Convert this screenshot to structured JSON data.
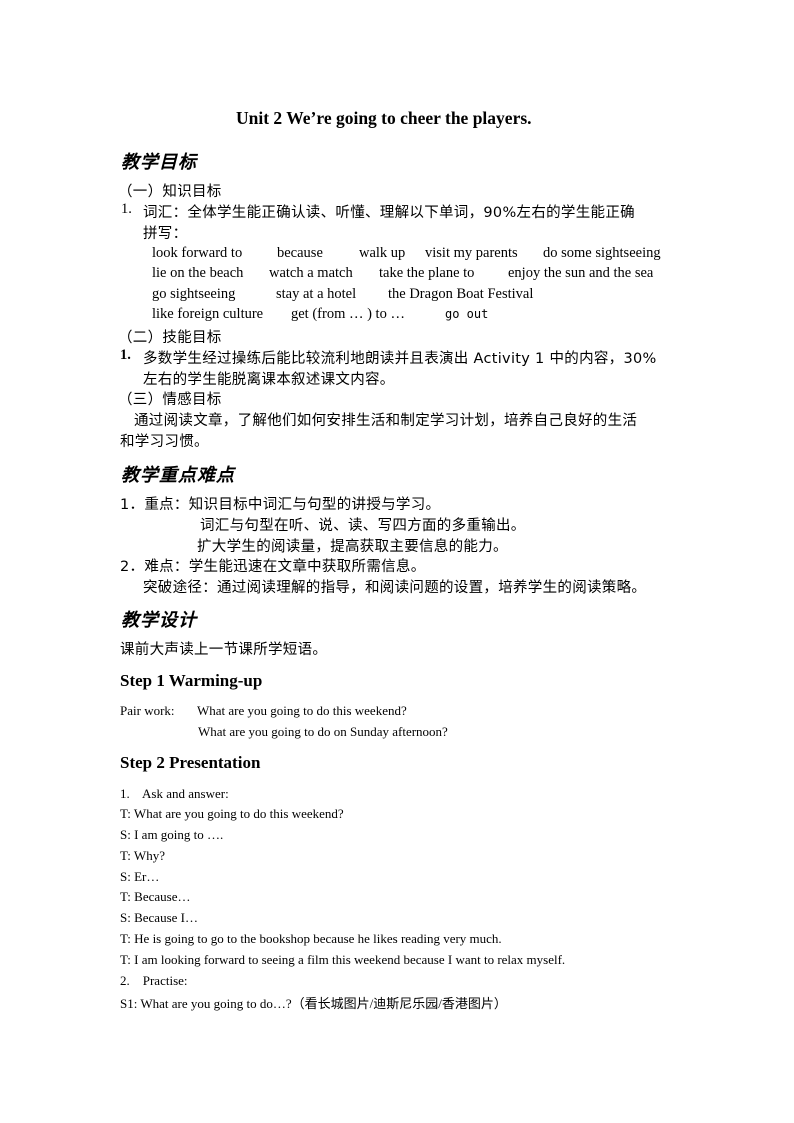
{
  "title": "Unit 2 We’re going to cheer the players.",
  "objectives": {
    "heading": "教学目标",
    "knowledge": {
      "label": "（一）知识目标",
      "item_num": "1.",
      "item_text_line1": "词汇：全体学生能正确认读、听懂、理解以下单词，90%左右的学生能正确",
      "item_text_line2": "拼写：",
      "vocab_rows": [
        [
          "look forward to",
          "because",
          "walk up",
          "visit my parents",
          "do some sightseeing"
        ],
        [
          "lie on the beach",
          "watch a match",
          "take the plane to",
          "enjoy the sun and the sea"
        ],
        [
          "go sightseeing",
          "stay at a hotel",
          "the Dragon Boat Festival"
        ],
        [
          "like foreign culture",
          "get (from …  ) to …",
          "go  out"
        ]
      ]
    },
    "skills": {
      "label": "（二）技能目标",
      "item_num": "1.",
      "item_text_line1": "多数学生经过操练后能比较流利地朗读并且表演出 Activity 1  中的内容，30%",
      "item_text_line2": "左右的学生能脱离课本叙述课文内容。"
    },
    "emotion": {
      "label": "（三）情感目标",
      "text_line1": "通过阅读文章，了解他们如何安排生活和制定学习计划，培养自己良好的生活",
      "text_line2": "和学习习惯。"
    }
  },
  "key_points": {
    "heading": "教学重点难点",
    "lines": [
      "1．重点：知识目标中词汇与句型的讲授与学习。",
      "词汇与句型在听、说、读、写四方面的多重输出。",
      "扩大学生的阅读量，提高获取主要信息的能力。",
      "2．难点：学生能迅速在文章中获取所需信息。",
      "突破途径：通过阅读理解的指导，和阅读问题的设置，培养学生的阅读策略。"
    ]
  },
  "design": {
    "heading": "教学设计",
    "intro": "课前大声读上一节课所学短语。"
  },
  "step1": {
    "heading": "Step 1 Warming-up",
    "label": "Pair work:",
    "lines": [
      "What are you going to do this weekend?",
      "What are you going to do on Sunday afternoon?"
    ]
  },
  "step2": {
    "heading": "Step 2 Presentation",
    "lines": [
      "1.    Ask and answer:",
      "T: What are you going to do this weekend?",
      "S: I am going to ….",
      "T: Why?",
      "S: Er…",
      "T: Because…",
      "S: Because I…",
      "T: He is going to go to the bookshop because he likes reading very much.",
      "T: I am looking forward to seeing a film this weekend because I want to relax myself.",
      "2.    Practise:",
      "S1: What are you going to do…?（看长城图片/迪斯尼乐园/香港图片）"
    ]
  }
}
